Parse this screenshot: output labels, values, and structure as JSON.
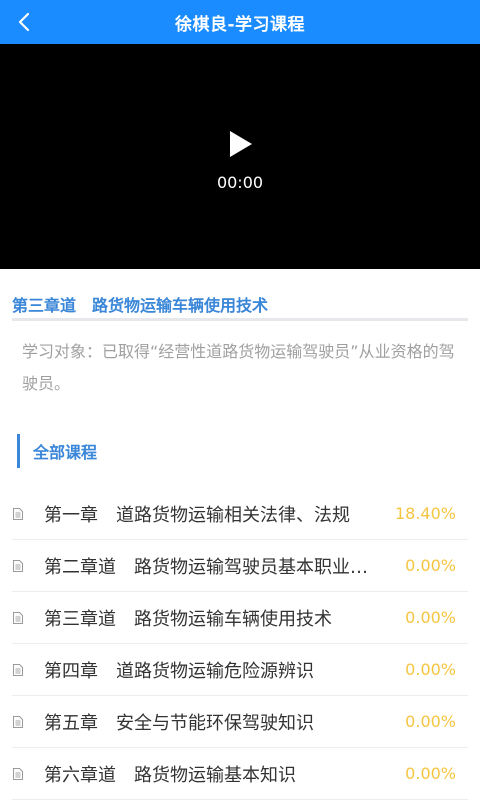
{
  "header": {
    "title": "徐棋良-学习课程",
    "back_icon": "chevron-left-icon"
  },
  "video": {
    "time": "00:00",
    "play_icon": "play-icon"
  },
  "chapter": {
    "title": "第三章道　路货物运输车辆使用技术",
    "audience": "学习对象：已取得“经营性道路货物运输驾驶员”从业资格的驾驶员。"
  },
  "section": {
    "title": "全部课程"
  },
  "colors": {
    "brand": "#1a8cff",
    "accent_text": "#3a86d8",
    "progress": "#f5c542"
  },
  "courses": [
    {
      "name": "第一章　道路货物运输相关法律、法规",
      "progress": "18.40%"
    },
    {
      "name": "第二章道　路货物运输驾驶员基本职业素养",
      "progress": "0.00%"
    },
    {
      "name": "第三章道　路货物运输车辆使用技术",
      "progress": "0.00%"
    },
    {
      "name": "第四章　道路货物运输危险源辨识",
      "progress": "0.00%"
    },
    {
      "name": "第五章　安全与节能环保驾驶知识",
      "progress": "0.00%"
    },
    {
      "name": "第六章道　路货物运输基本知识",
      "progress": "0.00%"
    }
  ]
}
